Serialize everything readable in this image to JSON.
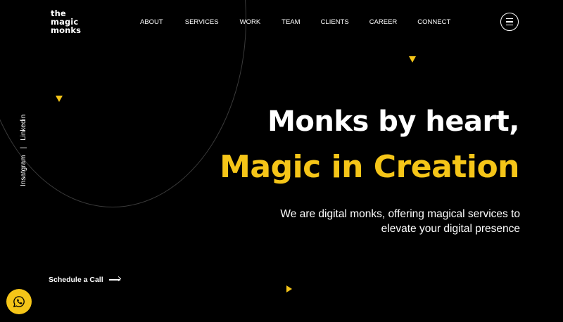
{
  "brand": {
    "logo_lines": [
      "the",
      "magic",
      "monks"
    ],
    "accent": "#f5c518"
  },
  "nav": [
    "ABOUT",
    "SERVICES",
    "WORK",
    "TEAM",
    "CLIENTS",
    "CAREER",
    "CONNECT"
  ],
  "social": {
    "instagram": "Insatgram",
    "separator": "|",
    "linkedin": "Linkedin"
  },
  "hero": {
    "headline": "Monks by heart,",
    "highlight": "Magic in Creation",
    "subtitle_lines": [
      "We are digital monks, offering magical services to",
      "elevate your digital presence"
    ]
  },
  "cta": {
    "label": "Schedule a Call"
  },
  "icons": {
    "menu": "hamburger-icon",
    "whatsapp": "whatsapp-icon",
    "arrow": "arrow-right-icon"
  }
}
